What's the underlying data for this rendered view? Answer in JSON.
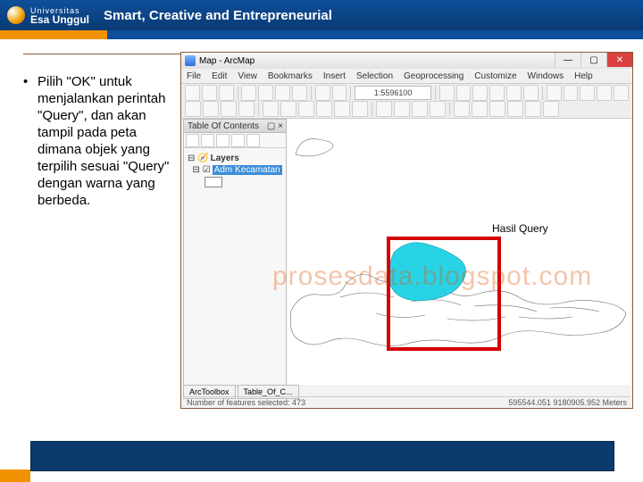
{
  "header": {
    "uni_small": "Universitas",
    "uni_name": "Esa Unggul",
    "tagline": "Smart, Creative and Entrepreneurial"
  },
  "bullet": "Pilih \"OK\" untuk menjalankan perintah \"Query\", dan akan tampil pada peta dimana objek yang terpilih sesuai \"Query\" dengan warna yang berbeda.",
  "arcmap": {
    "title": "Map - ArcMap",
    "menu": [
      "File",
      "Edit",
      "View",
      "Bookmarks",
      "Insert",
      "Selection",
      "Geoprocessing",
      "Customize",
      "Windows",
      "Help"
    ],
    "scale": "1:5596100",
    "toc_title": "Table Of Contents",
    "toc_x": "▢ ×",
    "layers_label": "Layers",
    "layer_name": "Adm Kecamatan",
    "label_hq": "Hasil Query",
    "tabs": [
      "ArcToolbox",
      "Table_Of_C..."
    ],
    "status_left": "Number of features selected: 473",
    "status_right": "595544.051  9180905.952 Meters"
  },
  "watermark": "prosesdata.blogspot.com"
}
